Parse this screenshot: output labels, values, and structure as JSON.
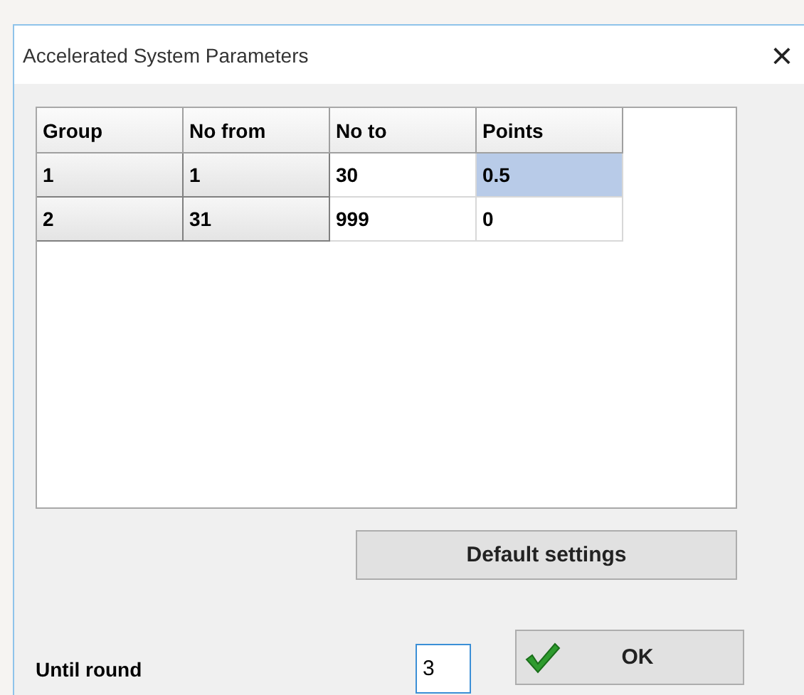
{
  "window": {
    "title": "Accelerated System Parameters",
    "close": "×"
  },
  "table": {
    "columns": [
      {
        "label": "Group",
        "kind": "rowheader"
      },
      {
        "label": "No from",
        "kind": "rowheader"
      },
      {
        "label": "No to",
        "kind": "data"
      },
      {
        "label": "Points",
        "kind": "data"
      }
    ],
    "rows": [
      {
        "cells": [
          {
            "text": "1",
            "selected": false
          },
          {
            "text": "1",
            "selected": false
          },
          {
            "text": "30",
            "selected": false
          },
          {
            "text": "0.5",
            "selected": true
          }
        ]
      },
      {
        "cells": [
          {
            "text": "2",
            "selected": false
          },
          {
            "text": "31",
            "selected": false
          },
          {
            "text": "999",
            "selected": false
          },
          {
            "text": "0",
            "selected": false
          }
        ]
      }
    ]
  },
  "default_button": "Default settings",
  "until_round": {
    "label": "Until round",
    "value": "3"
  },
  "ok_button": "OK"
}
